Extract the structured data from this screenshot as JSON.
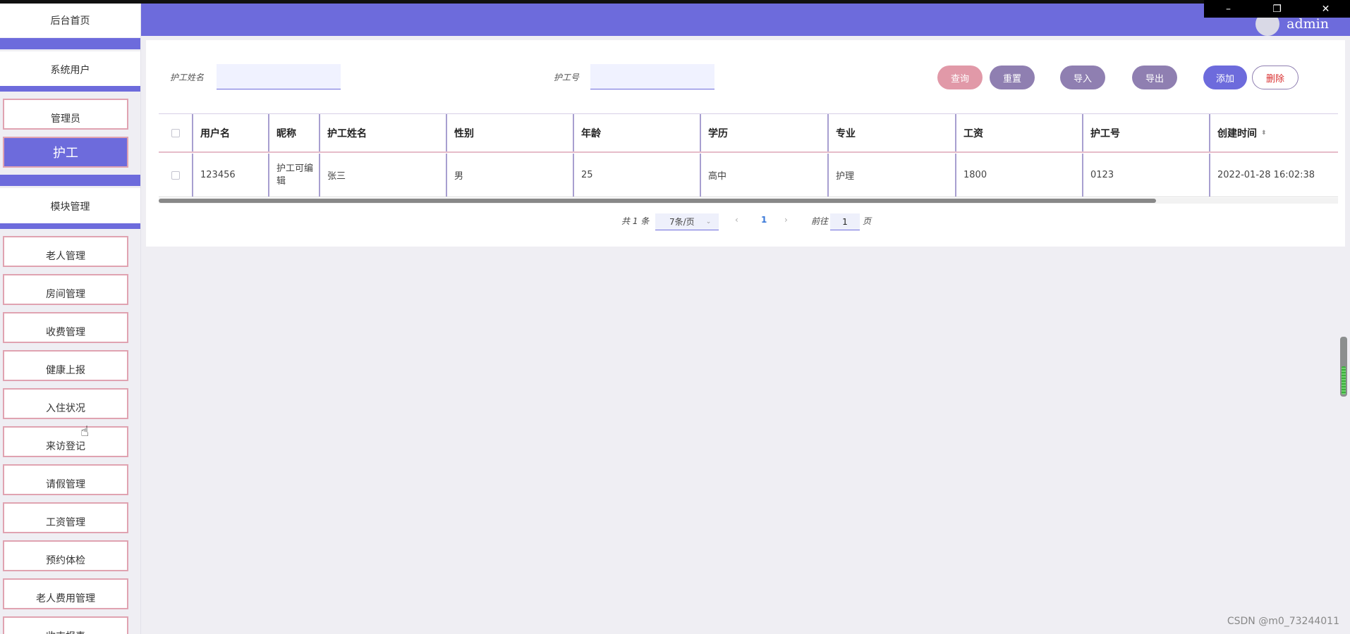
{
  "window": {
    "minimize": "–",
    "restore": "❐",
    "close": "✕"
  },
  "header": {
    "username": "admin"
  },
  "sidebar": {
    "home": "后台首页",
    "system_users": "系统用户",
    "admin": "管理员",
    "caregiver": "护工",
    "module_management": "模块管理",
    "modules": [
      "老人管理",
      "房间管理",
      "收费管理",
      "健康上报",
      "入住状况",
      "来访登记",
      "请假管理",
      "工资管理",
      "预约体检",
      "老人费用管理",
      "收支报表"
    ]
  },
  "search": {
    "caregiver_name_label": "护工姓名",
    "caregiver_no_label": "护工号",
    "caregiver_name_value": "",
    "caregiver_no_value": ""
  },
  "toolbar": {
    "query": "查询",
    "reset": "重置",
    "import": "导入",
    "export": "导出",
    "add": "添加",
    "delete": "删除"
  },
  "colors": {
    "accent": "#6d6bdc",
    "query": "#e199a8",
    "muted": "#8f7fb1",
    "delete_text": "#d93030"
  },
  "table": {
    "headers": [
      "用户名",
      "昵称",
      "护工姓名",
      "性别",
      "年龄",
      "学历",
      "专业",
      "工资",
      "护工号",
      "创建时间"
    ],
    "rows": [
      [
        "123456",
        "护工可编辑",
        "张三",
        "男",
        "25",
        "高中",
        "护理",
        "1800",
        "0123",
        "2022-01-28 16:02:38"
      ]
    ]
  },
  "pagination": {
    "total": "共 1 条",
    "page_size": "7条/页",
    "current_page": "1",
    "goto_prefix": "前往",
    "goto_value": "1",
    "goto_suffix": "页"
  },
  "watermark": "CSDN @m0_73244011"
}
